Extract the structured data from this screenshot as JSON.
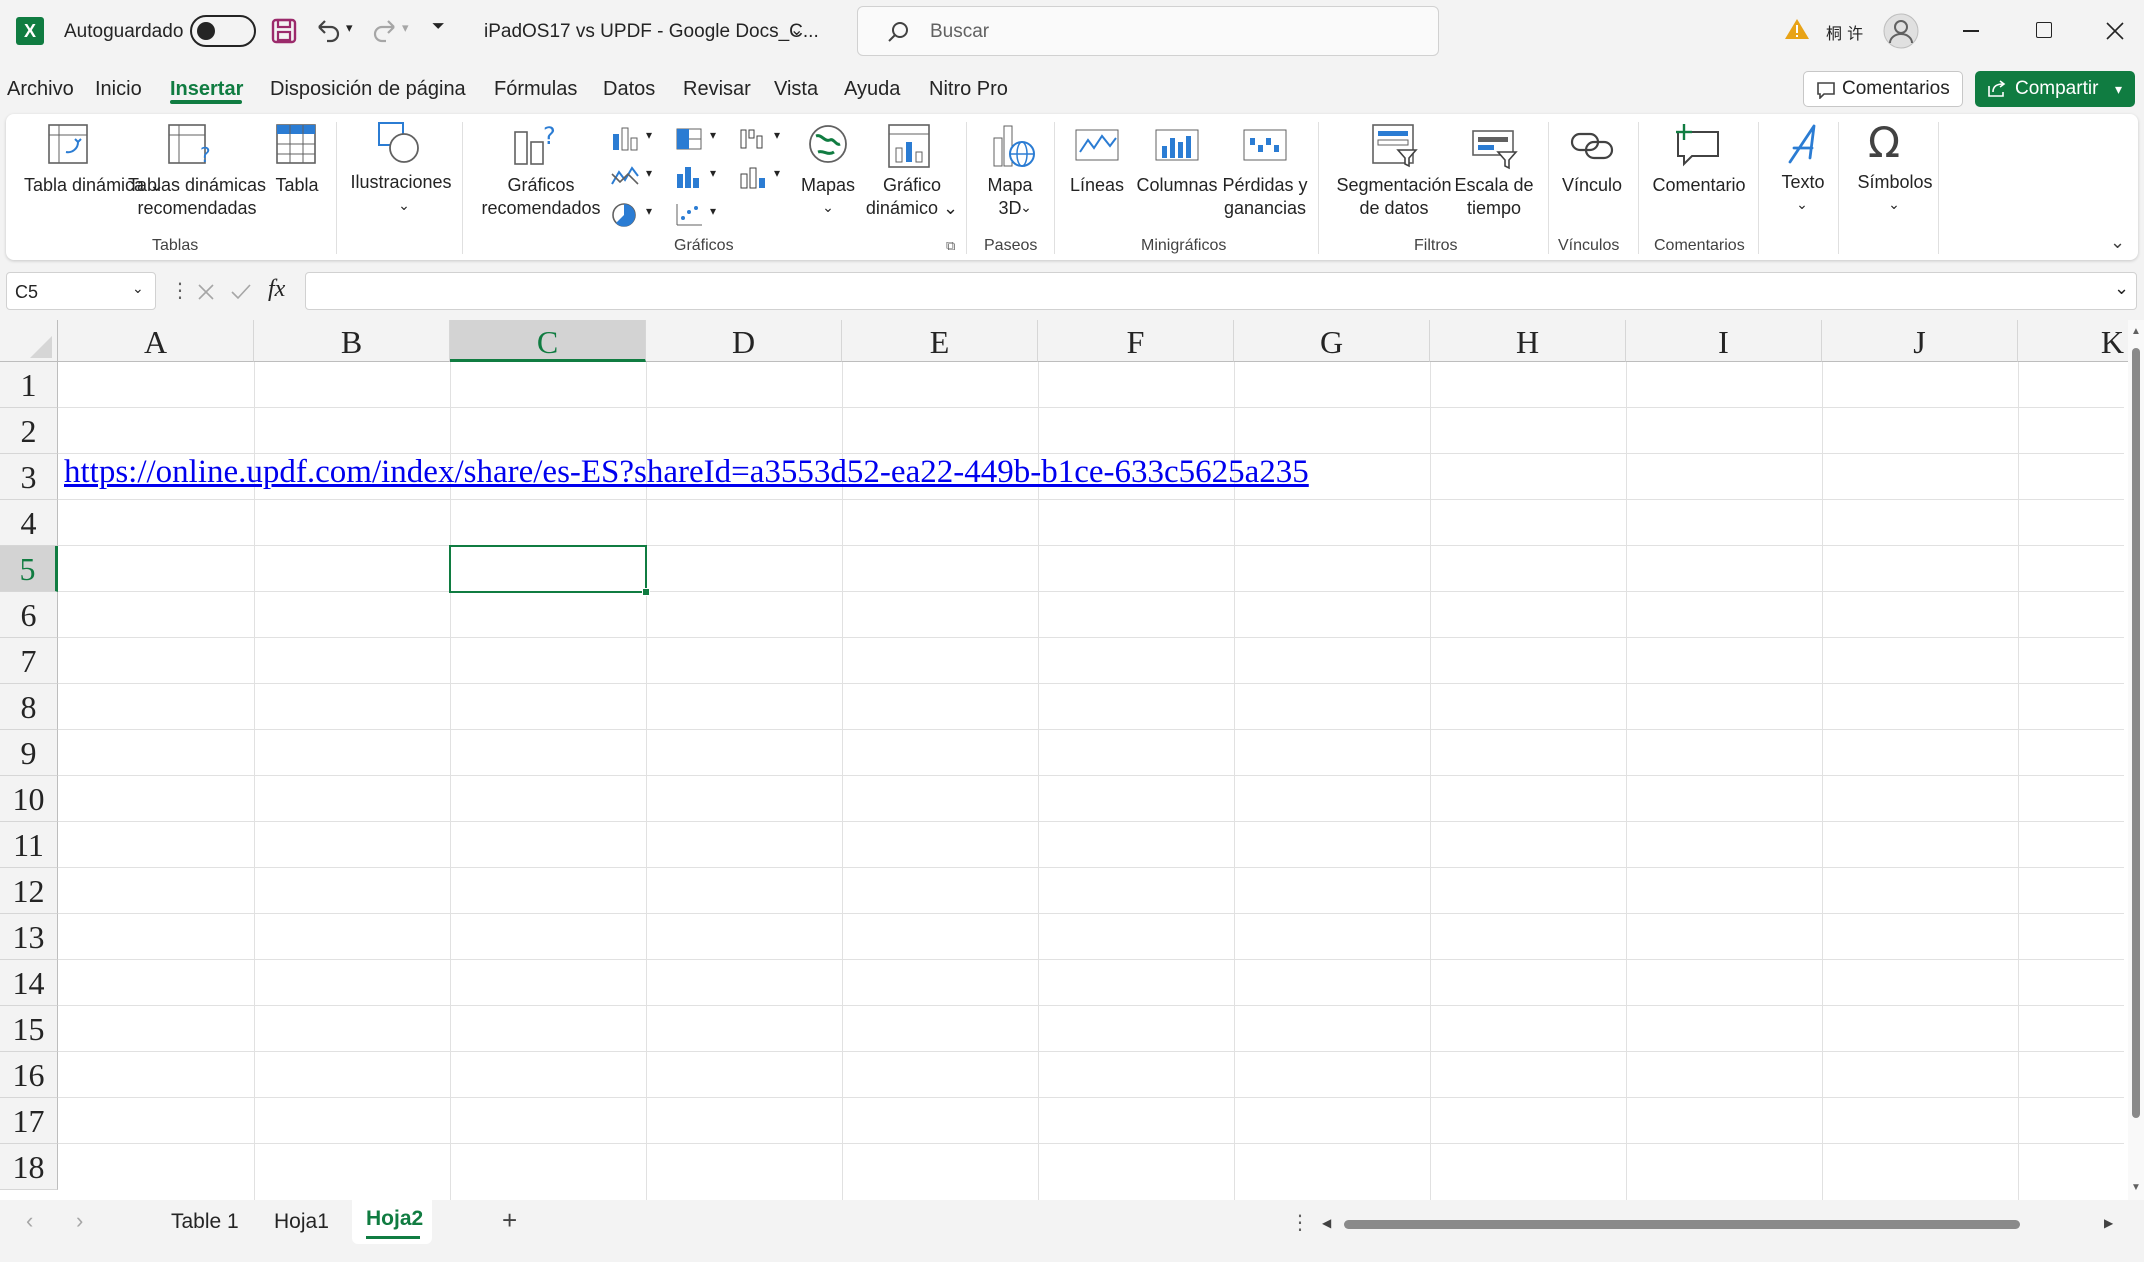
{
  "titlebar": {
    "app_icon": "excel-logo",
    "autosave_label": "Autoguardado",
    "doc_title": "iPadOS17 vs UPDF - Google Docs_C...",
    "search_placeholder": "Buscar",
    "user_name": "桐 许"
  },
  "menu": {
    "items": [
      "Archivo",
      "Inicio",
      "Insertar",
      "Disposición de página",
      "Fórmulas",
      "Datos",
      "Revisar",
      "Vista",
      "Ayuda",
      "Nitro Pro"
    ],
    "active": "Insertar",
    "comments_label": "Comentarios",
    "share_label": "Compartir"
  },
  "ribbon": {
    "pivot_table": "Tabla dinámica",
    "recommended_pivots": "Tablas dinámicas recomendadas",
    "table": "Tabla",
    "illustrations": "Ilustraciones",
    "recommended_charts": "Gráficos recomendados",
    "maps": "Mapas",
    "pivot_chart": "Gráfico dinámico",
    "map3d": "Mapa 3D",
    "lines": "Líneas",
    "columns": "Columnas",
    "winloss": "Pérdidas y ganancias",
    "slicer": "Segmentación de datos",
    "timeline": "Escala de tiempo",
    "link": "Vínculo",
    "comment": "Comentario",
    "text": "Texto",
    "symbols": "Símbolos",
    "groups": {
      "tables": "Tablas",
      "charts": "Gráficos",
      "tours": "Paseos",
      "sparklines": "Minigráficos",
      "filters": "Filtros",
      "links": "Vínculos",
      "comments": "Comentarios"
    }
  },
  "formula_bar": {
    "name_box": "C5",
    "fx": "fx",
    "value": ""
  },
  "grid": {
    "columns": [
      "A",
      "B",
      "C",
      "D",
      "E",
      "F",
      "G",
      "H",
      "I",
      "J",
      "K"
    ],
    "selected_column": "C",
    "rows": [
      "1",
      "2",
      "3",
      "4",
      "5",
      "6",
      "7",
      "8",
      "9",
      "10",
      "11",
      "12",
      "13",
      "14",
      "15",
      "16",
      "17",
      "18"
    ],
    "selected_row": "5",
    "cell_A3": "https://online.updf.com/index/share/es-ES?shareId=a3553d52-ea22-449b-b1ce-633c5625a235"
  },
  "sheets": {
    "tabs": [
      "Table 1",
      "Hoja1",
      "Hoja2"
    ],
    "active": "Hoja2",
    "add": "+"
  },
  "colors": {
    "accent": "#107c41",
    "link": "#0000ee"
  }
}
